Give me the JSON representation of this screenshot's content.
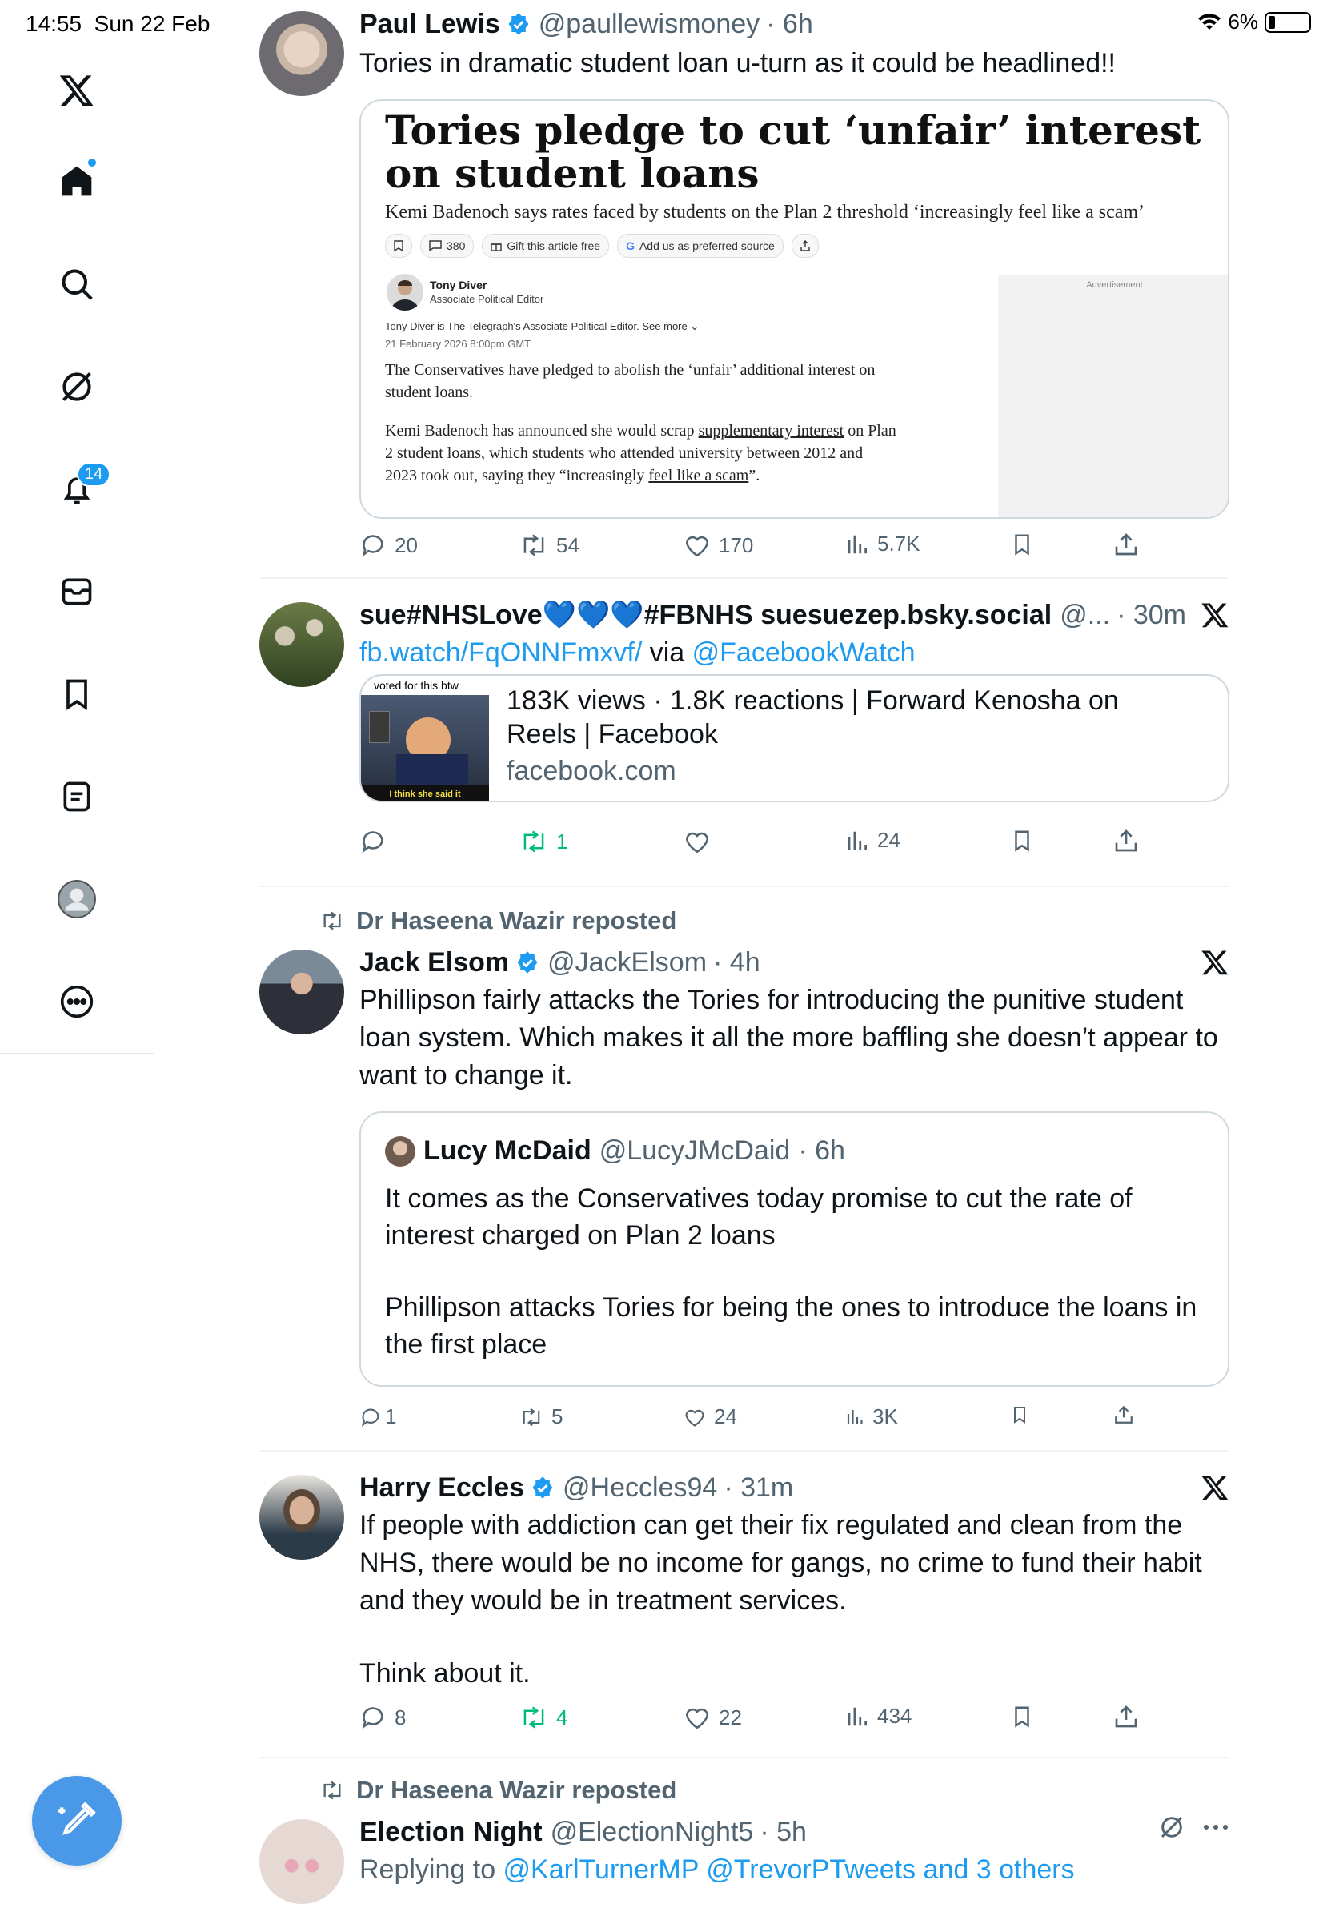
{
  "status": {
    "time": "14:55",
    "date": "Sun 22 Feb",
    "battery": "6%"
  },
  "sidebar": {
    "notifications_badge": "14"
  },
  "posts": [
    {
      "name": "Paul Lewis",
      "handle": "@paullewismoney",
      "time": "· 6h",
      "text": "Tories in dramatic student loan u-turn as it could be headlined!!",
      "article": {
        "headline": "Tories pledge to cut ‘unfair’ interest on student loans",
        "standfirst": "Kemi Badenoch says rates faced by students on the Plan 2 threshold ‘increasingly feel like a scam’",
        "chip_comments": "380",
        "chip_gift": "Gift this article free",
        "chip_source": "Add us as preferred source",
        "author": "Tony Diver",
        "role": "Associate Political Editor",
        "bio": "Tony Diver is The Telegraph's Associate Political Editor. See more",
        "date": "21 February 2026 8:00pm GMT",
        "para1": "The Conservatives have pledged to abolish the ‘unfair’ additional interest on student loans.",
        "para2_a": "Kemi Badenoch has announced she would scrap ",
        "para2_link1": "supplementary interest",
        "para2_b": " on Plan 2 student loans, which students who attended university between 2012 and 2023 took out, saying they “increasingly ",
        "para2_link2": "feel like a scam",
        "para2_c": "”.",
        "ad_label": "Advertisement"
      },
      "stats": {
        "replies": "20",
        "reposts": "54",
        "likes": "170",
        "views": "5.7K"
      }
    },
    {
      "name": "sue#NHSLove💙💙💙#FBNHS suesuezep.bsky.social",
      "handle": "@...",
      "time": "· 30m",
      "link1": "fb.watch/FqONNFmxvf/",
      "via": " via ",
      "link2": "@FacebookWatch",
      "card_title": "183K views · 1.8K reactions | Forward Kenosha on Reels | Facebook",
      "card_domain": "facebook.com",
      "thumb_top": "voted for this btw",
      "thumb_bottom": "I think she said it",
      "stats": {
        "replies": "",
        "reposts": "1",
        "likes": "",
        "views": "24"
      }
    },
    {
      "repost_by": "Dr Haseena Wazir reposted",
      "name": "Jack Elsom",
      "handle": "@JackElsom",
      "time": "· 4h",
      "text": "Phillipson fairly attacks the Tories for introducing the punitive student loan system. Which makes it all the more baffling she doesn’t appear to want to change it.",
      "quote": {
        "name": "Lucy McDaid",
        "handle": "@LucyJMcDaid",
        "time": "· 6h",
        "text1": "It comes as the Conservatives today promise to cut the rate of interest charged on Plan 2 loans",
        "text2": "Phillipson attacks Tories for being the ones to introduce the loans in the first place"
      },
      "stats": {
        "replies": "1",
        "reposts": "5",
        "likes": "24",
        "views": "3K"
      }
    },
    {
      "name": "Harry Eccles",
      "handle": "@Heccles94",
      "time": "· 31m",
      "text1": "If people with addiction can get their fix regulated and clean from the NHS, there would be no income for gangs, no crime to fund their habit and they would be in treatment services.",
      "text2": "Think about it.",
      "stats": {
        "replies": "8",
        "reposts": "4",
        "likes": "22",
        "views": "434"
      }
    },
    {
      "repost_by": "Dr Haseena Wazir reposted",
      "name": "Election Night",
      "handle": "@ElectionNight5",
      "time": "· 5h",
      "replying_prefix": "Replying to ",
      "replying_to": "@KarlTurnerMP @TrevorPTweets and 3 others"
    }
  ],
  "colors": {
    "accent": "#1d9bf0",
    "muted": "#536471",
    "repost_green": "#00ba7c"
  }
}
